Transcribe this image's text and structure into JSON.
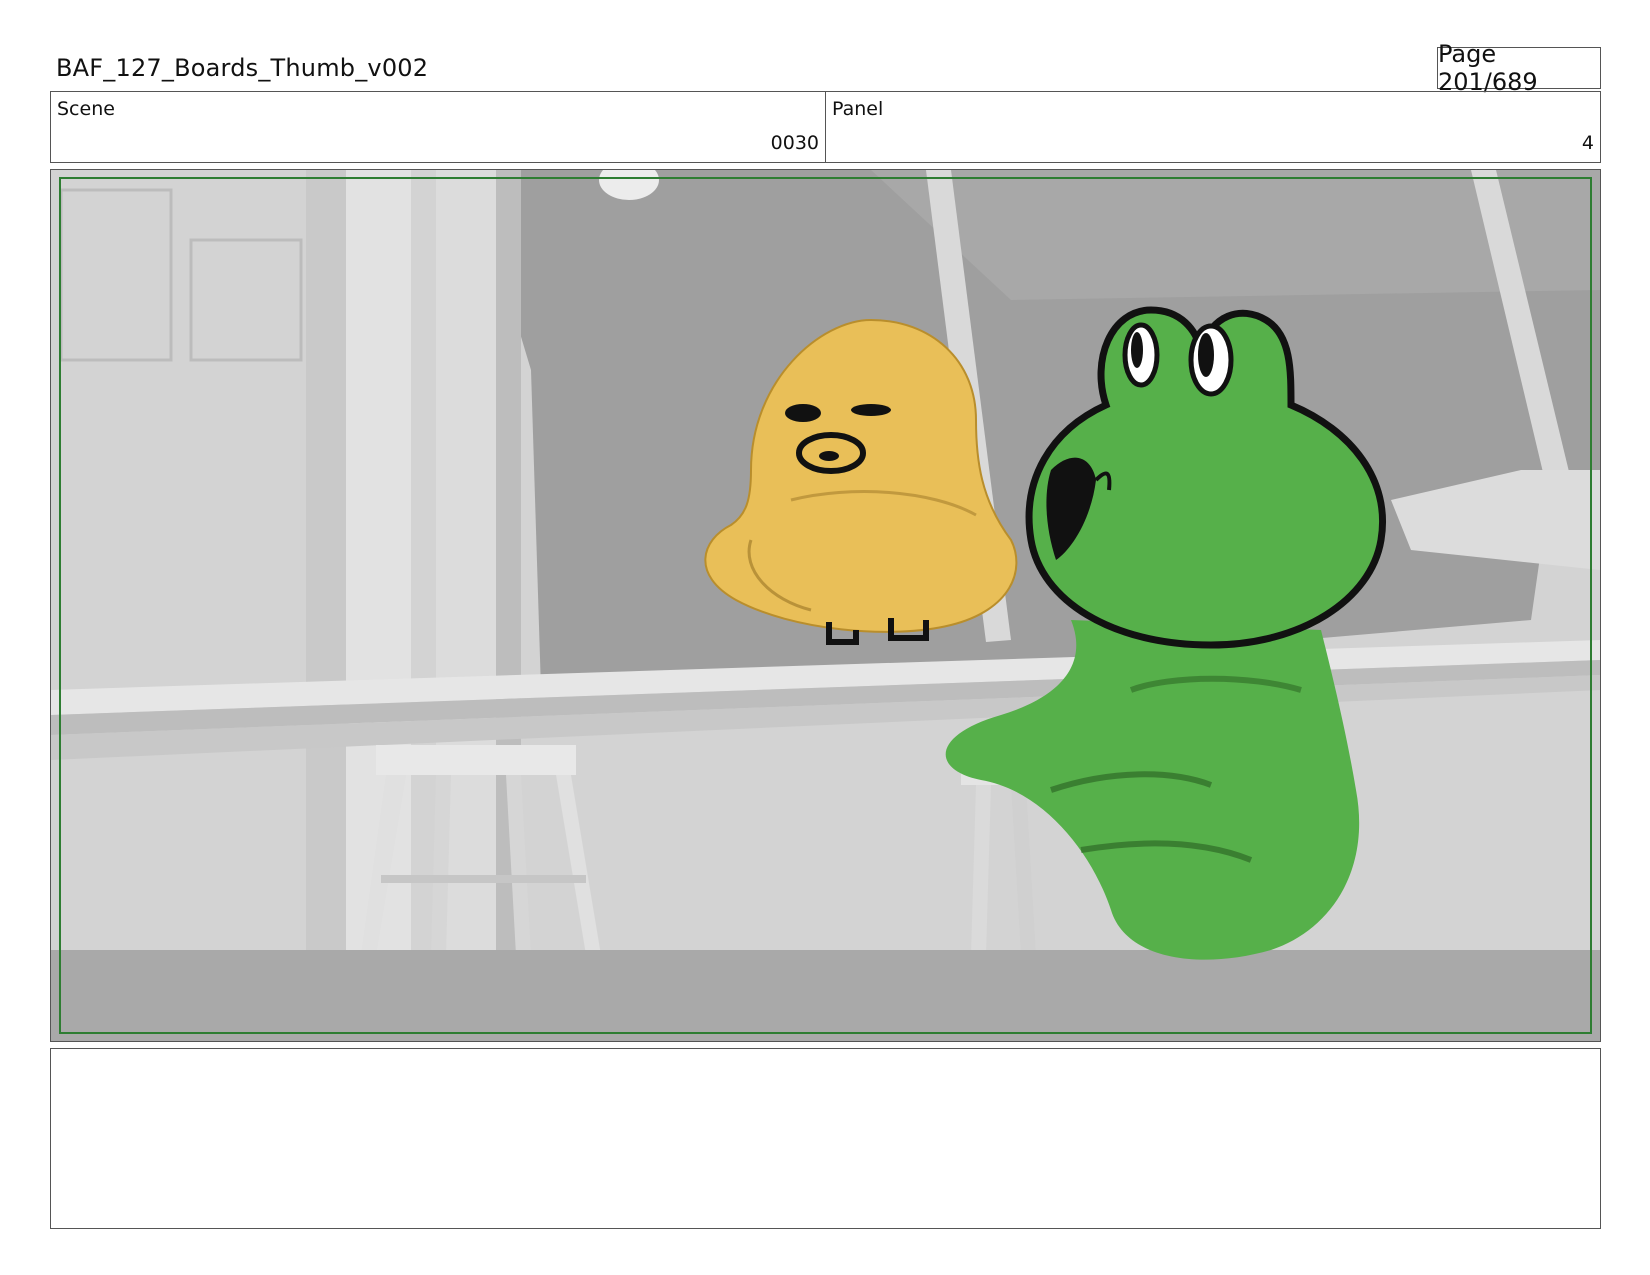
{
  "header": {
    "title": "BAF_127_Boards_Thumb_v002",
    "page_label": "Page 201/689"
  },
  "info": {
    "scene_label": "Scene",
    "scene_value": "0030",
    "panel_label": "Panel",
    "panel_value": "4"
  },
  "panel": {
    "safe_frame_color": "#2e7d32",
    "duck_color": "#e9bf58",
    "frog_color": "#56b04a",
    "outline_color": "#111111"
  },
  "notes": {
    "text": ""
  }
}
